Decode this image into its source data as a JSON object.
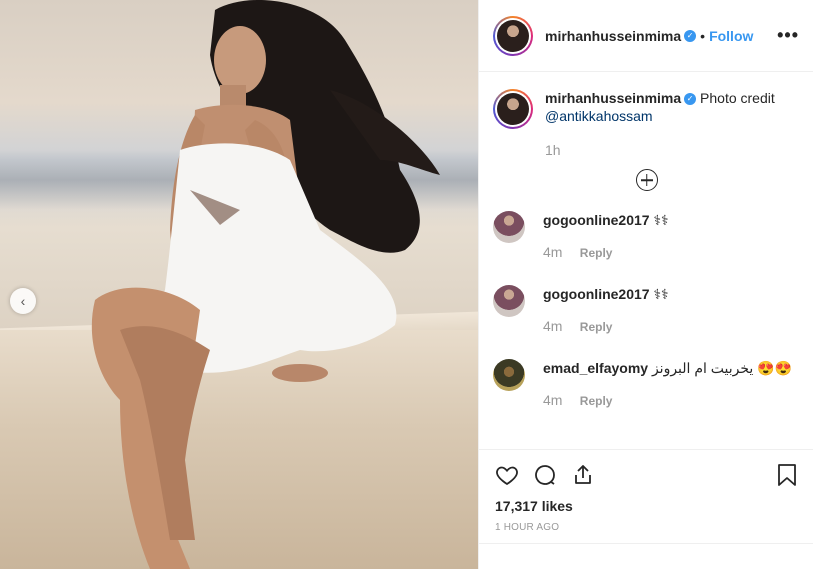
{
  "photo": {
    "nav_prev_icon": "chevron-left-icon"
  },
  "header": {
    "username": "mirhanhusseinmima",
    "separator": "•",
    "follow_label": "Follow",
    "more_label": "•••"
  },
  "caption": {
    "username": "mirhanhusseinmima",
    "text": "Photo credit",
    "mention": "@antikkahossam",
    "time": "1h"
  },
  "comments": [
    {
      "username": "gogoonline2017",
      "text": "⚕⚕",
      "time": "4m",
      "reply_label": "Reply"
    },
    {
      "username": "gogoonline2017",
      "text": "⚕⚕",
      "time": "4m",
      "reply_label": "Reply"
    },
    {
      "username": "emad_elfayomy",
      "text": "يخربيت ام البرونز 😍😍",
      "time": "4m",
      "reply_label": "Reply"
    }
  ],
  "actions": {
    "likes": "17,317 likes",
    "posted": "1 HOUR AGO"
  },
  "colors": {
    "accent": "#3897f0",
    "text": "#262626",
    "muted": "#999999",
    "border": "#efefef"
  }
}
